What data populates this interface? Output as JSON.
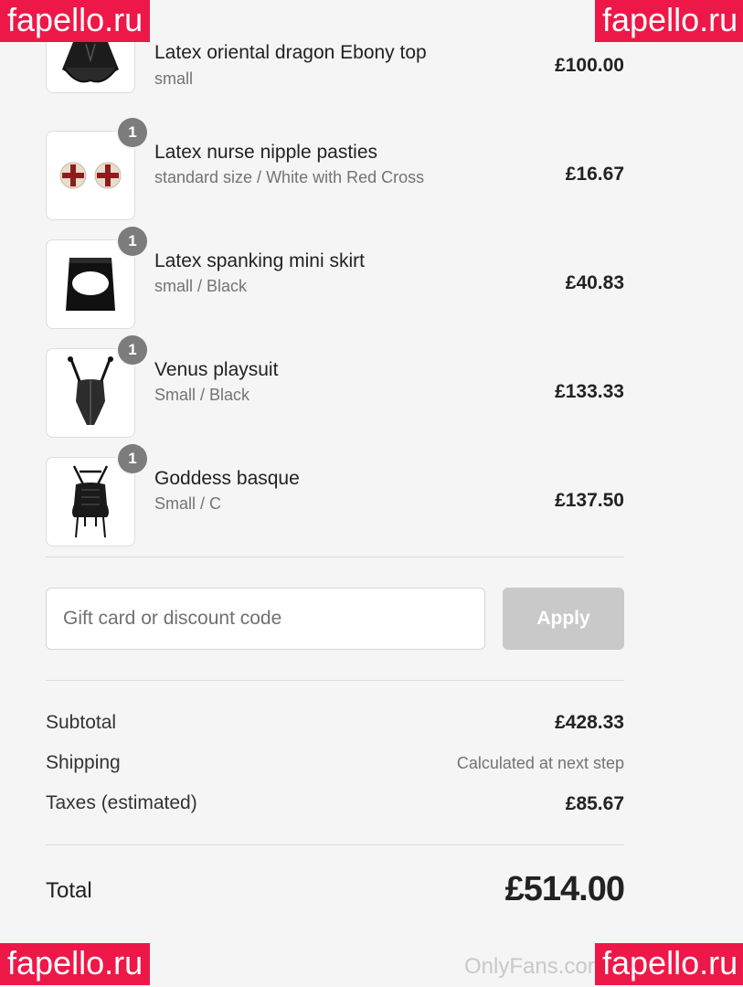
{
  "items": [
    {
      "name": "Latex oriental dragon Ebony top",
      "variant": "small",
      "price": "£100.00",
      "qty": "",
      "image_icon": "latex-top-icon"
    },
    {
      "name": "Latex nurse nipple pasties",
      "variant": "standard size / White with Red Cross",
      "price": "£16.67",
      "qty": "1",
      "image_icon": "pasties-icon"
    },
    {
      "name": "Latex spanking mini skirt",
      "variant": "small / Black",
      "price": "£40.83",
      "qty": "1",
      "image_icon": "skirt-icon"
    },
    {
      "name": "Venus playsuit",
      "variant": "Small / Black",
      "price": "£133.33",
      "qty": "1",
      "image_icon": "playsuit-icon"
    },
    {
      "name": "Goddess basque",
      "variant": "Small / C",
      "price": "£137.50",
      "qty": "1",
      "image_icon": "basque-icon"
    }
  ],
  "discount": {
    "placeholder": "Gift card or discount code",
    "value": "",
    "apply_label": "Apply"
  },
  "summary": {
    "subtotal_label": "Subtotal",
    "subtotal_value": "£428.33",
    "shipping_label": "Shipping",
    "shipping_value": "Calculated at next step",
    "taxes_label": "Taxes (estimated)",
    "taxes_value": "£85.67",
    "total_label": "Total",
    "total_value": "£514.00"
  },
  "watermarks": {
    "site": "fapello.ru",
    "onlyfans": "OnlyFans.com/"
  },
  "colors": {
    "background": "#f5f5f5",
    "badge": "#7c7c7c",
    "apply_button": "#c9c9c9",
    "watermark": "#ee1848"
  }
}
